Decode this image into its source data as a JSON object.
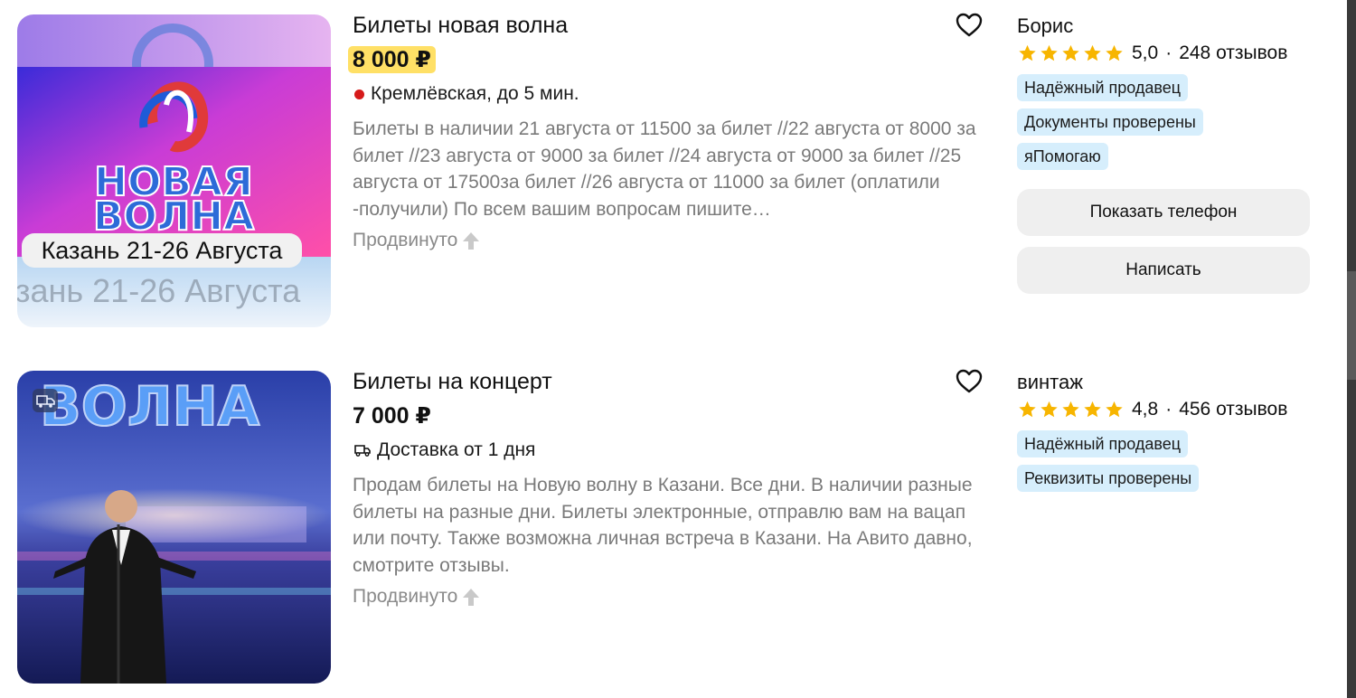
{
  "listings": [
    {
      "title": "Билеты новая волна",
      "price": "8 000 ₽",
      "location": "Кремлёвская, до 5 мин.",
      "description": "Билеты в наличии 21 августа от 11500 за билет //22 августа от 8000 за билет //23 августа от 9000 за билет //24 августа от 9000 за билет //25 августа от 17500за билет //26 августа от 11000 за билет (оплатили -получили) По всем вашим вопросам пишите…",
      "promo": "Продвинуто",
      "image": {
        "logo_line1": "НОВАЯ",
        "logo_line2": "ВОЛНА",
        "caption": "Казань 21-26 Августа",
        "caption_ghost": "зань 21-26 Августа"
      },
      "seller": {
        "name": "Борис",
        "rating": "5,0",
        "reviews": "248 отзывов",
        "badges": [
          "Надёжный продавец",
          "Документы проверены",
          "яПомогаю"
        ]
      },
      "buttons": {
        "phone": "Показать телефон",
        "write": "Написать"
      }
    },
    {
      "title": "Билеты на концерт",
      "price": "7 000 ₽",
      "delivery": "Доставка от 1 дня",
      "description": "Продам билеты на Новую волну в Казани. Все дни. В наличии разные билеты на разные дни. Билеты электронные, отправлю вам на вацап или почту. Также возможна личная встреча в Казани. На Авито давно, смотрите отзывы.",
      "promo": "Продвинуто",
      "image": {
        "banner": "ВОЛНА"
      },
      "seller": {
        "name": "винтаж",
        "rating": "4,8",
        "reviews": "456 отзывов",
        "badges": [
          "Надёжный продавец",
          "Реквизиты проверены"
        ]
      }
    }
  ],
  "colors": {
    "price_highlight": "#ffe066",
    "badge_bg": "#d6eefc",
    "star": "#f7b500",
    "metro_dot": "#d61a1a",
    "button_bg": "#efefef"
  }
}
